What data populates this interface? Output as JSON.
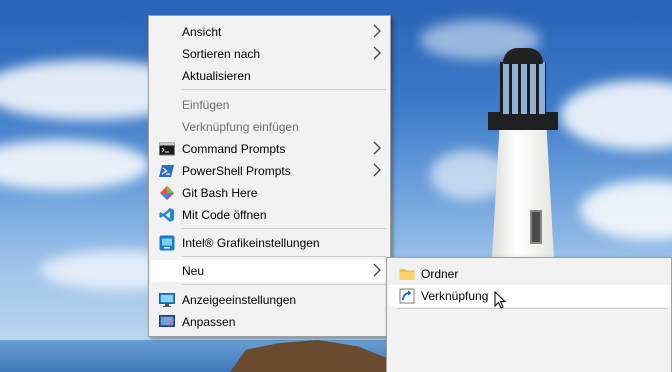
{
  "menu": {
    "items": [
      {
        "label": "Ansicht"
      },
      {
        "label": "Sortieren nach"
      },
      {
        "label": "Aktualisieren"
      },
      {
        "label": "Einfügen"
      },
      {
        "label": "Verknüpfung einfügen"
      },
      {
        "label": "Command Prompts"
      },
      {
        "label": "PowerShell Prompts"
      },
      {
        "label": "Git Bash Here"
      },
      {
        "label": "Mit Code öffnen"
      },
      {
        "label": "Intel® Grafikeinstellungen"
      },
      {
        "label": "Neu"
      },
      {
        "label": "Anzeigeeinstellungen"
      },
      {
        "label": "Anpassen"
      }
    ]
  },
  "submenu": {
    "items": [
      {
        "label": "Ordner"
      },
      {
        "label": "Verknüpfung"
      }
    ]
  },
  "colors": {
    "menu_bg": "#f2f2f2",
    "hover_bg": "#ffffff",
    "disabled_text": "#6d6d6d",
    "separator": "#cfcfcf"
  }
}
